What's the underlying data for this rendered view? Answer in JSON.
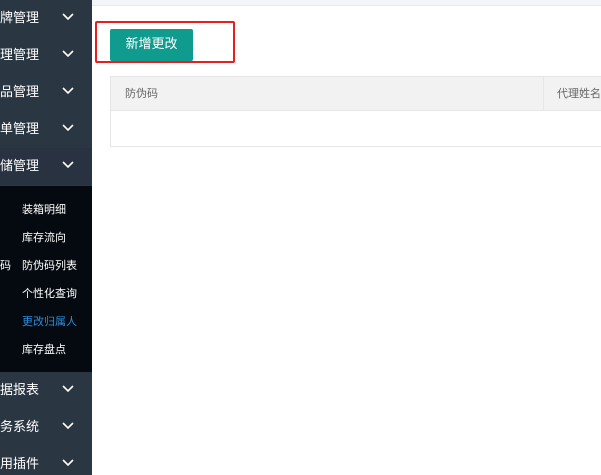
{
  "sidebar": {
    "menu_top": [
      {
        "label": "牌管理"
      },
      {
        "label": "理管理"
      },
      {
        "label": "品管理"
      },
      {
        "label": "单管理"
      },
      {
        "label": "储管理"
      }
    ],
    "submenu": [
      {
        "label": "装箱明细",
        "prefix": ""
      },
      {
        "label": "库存流向",
        "prefix": ""
      },
      {
        "label": "防伪码列表",
        "prefix": "码"
      },
      {
        "label": "个性化查询",
        "prefix": ""
      },
      {
        "label": "更改归属人",
        "prefix": ""
      },
      {
        "label": "库存盘点",
        "prefix": ""
      }
    ],
    "menu_bottom": [
      {
        "label": "据报表"
      },
      {
        "label": "务系统"
      },
      {
        "label": "用插件"
      }
    ]
  },
  "toolbar": {
    "add_label": "新增更改"
  },
  "table": {
    "columns": [
      "防伪码",
      "代理姓名"
    ]
  },
  "colors": {
    "sidebar_bg": "#2b3643",
    "submenu_bg": "#040a10",
    "active_link": "#2c8bdb",
    "primary_button": "#109b8f",
    "highlight_box": "#e81f1f"
  }
}
